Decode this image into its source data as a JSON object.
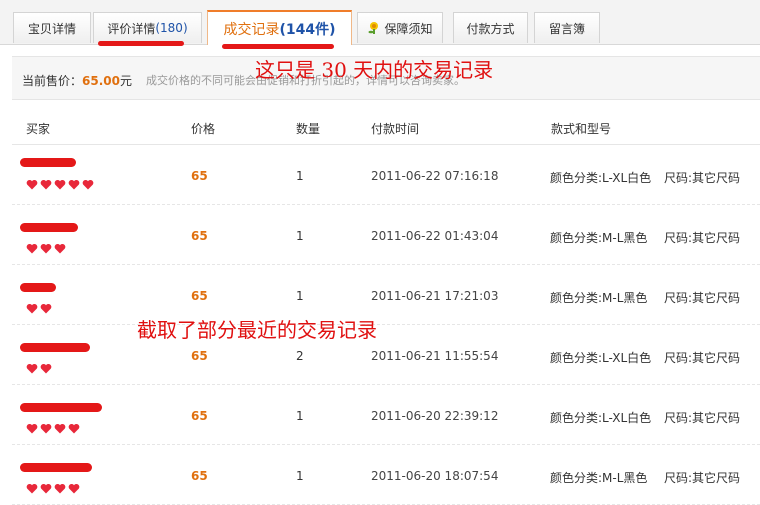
{
  "tabs": [
    {
      "label": "宝贝详情",
      "count": ""
    },
    {
      "label": "评价详情",
      "count": "(180)"
    },
    {
      "label": "成交记录",
      "count": "(144件)"
    },
    {
      "label": "保障须知",
      "count": ""
    },
    {
      "label": "付款方式",
      "count": ""
    },
    {
      "label": "留言簿",
      "count": ""
    }
  ],
  "price_bar": {
    "label": "当前售价：",
    "value": "65.00",
    "unit": "元",
    "note": "成交价格的不同可能会由促销和打折引起的，详情可以咨询卖家。"
  },
  "annotations": {
    "top": "这只是 30 天内的交易记录",
    "middle": "截取了部分最近的交易记录"
  },
  "table": {
    "headers": [
      "买家",
      "价格",
      "数量",
      "付款时间",
      "款式和型号"
    ],
    "rows": [
      {
        "price": "65",
        "qty": "1",
        "time": "2011-06-22 07:16:18",
        "color": "颜色分类:L-XL白色",
        "size": "尺码:其它尺码",
        "hearts": 5
      },
      {
        "price": "65",
        "qty": "1",
        "time": "2011-06-22 01:43:04",
        "color": "颜色分类:M-L黑色",
        "size": "尺码:其它尺码",
        "hearts": 3
      },
      {
        "price": "65",
        "qty": "1",
        "time": "2011-06-21 17:21:03",
        "color": "颜色分类:M-L黑色",
        "size": "尺码:其它尺码",
        "hearts": 2
      },
      {
        "price": "65",
        "qty": "2",
        "time": "2011-06-21 11:55:54",
        "color": "颜色分类:L-XL白色",
        "size": "尺码:其它尺码",
        "hearts": 2
      },
      {
        "price": "65",
        "qty": "1",
        "time": "2011-06-20 22:39:12",
        "color": "颜色分类:L-XL白色",
        "size": "尺码:其它尺码",
        "hearts": 4
      },
      {
        "price": "65",
        "qty": "1",
        "time": "2011-06-20 18:07:54",
        "color": "颜色分类:M-L黑色",
        "size": "尺码:其它尺码",
        "hearts": 4
      }
    ]
  },
  "colors": {
    "accent": "#e0700f",
    "annotation": "#e01010",
    "count": "#1f53a8"
  },
  "icons": {
    "tab3": "shield-flower-icon",
    "rating": "heart-icon"
  }
}
